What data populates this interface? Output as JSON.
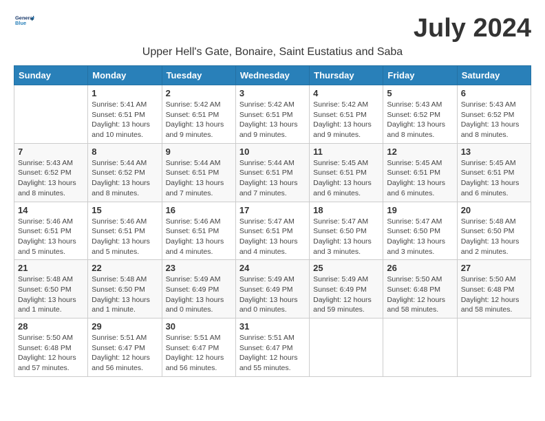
{
  "header": {
    "logo_line1": "General",
    "logo_line2": "Blue",
    "month_year": "July 2024",
    "location": "Upper Hell's Gate, Bonaire, Saint Eustatius and Saba"
  },
  "weekdays": [
    "Sunday",
    "Monday",
    "Tuesday",
    "Wednesday",
    "Thursday",
    "Friday",
    "Saturday"
  ],
  "weeks": [
    [
      {
        "day": "",
        "info": ""
      },
      {
        "day": "1",
        "info": "Sunrise: 5:41 AM\nSunset: 6:51 PM\nDaylight: 13 hours\nand 10 minutes."
      },
      {
        "day": "2",
        "info": "Sunrise: 5:42 AM\nSunset: 6:51 PM\nDaylight: 13 hours\nand 9 minutes."
      },
      {
        "day": "3",
        "info": "Sunrise: 5:42 AM\nSunset: 6:51 PM\nDaylight: 13 hours\nand 9 minutes."
      },
      {
        "day": "4",
        "info": "Sunrise: 5:42 AM\nSunset: 6:51 PM\nDaylight: 13 hours\nand 9 minutes."
      },
      {
        "day": "5",
        "info": "Sunrise: 5:43 AM\nSunset: 6:52 PM\nDaylight: 13 hours\nand 8 minutes."
      },
      {
        "day": "6",
        "info": "Sunrise: 5:43 AM\nSunset: 6:52 PM\nDaylight: 13 hours\nand 8 minutes."
      }
    ],
    [
      {
        "day": "7",
        "info": "Sunrise: 5:43 AM\nSunset: 6:52 PM\nDaylight: 13 hours\nand 8 minutes."
      },
      {
        "day": "8",
        "info": "Sunrise: 5:44 AM\nSunset: 6:52 PM\nDaylight: 13 hours\nand 8 minutes."
      },
      {
        "day": "9",
        "info": "Sunrise: 5:44 AM\nSunset: 6:51 PM\nDaylight: 13 hours\nand 7 minutes."
      },
      {
        "day": "10",
        "info": "Sunrise: 5:44 AM\nSunset: 6:51 PM\nDaylight: 13 hours\nand 7 minutes."
      },
      {
        "day": "11",
        "info": "Sunrise: 5:45 AM\nSunset: 6:51 PM\nDaylight: 13 hours\nand 6 minutes."
      },
      {
        "day": "12",
        "info": "Sunrise: 5:45 AM\nSunset: 6:51 PM\nDaylight: 13 hours\nand 6 minutes."
      },
      {
        "day": "13",
        "info": "Sunrise: 5:45 AM\nSunset: 6:51 PM\nDaylight: 13 hours\nand 6 minutes."
      }
    ],
    [
      {
        "day": "14",
        "info": "Sunrise: 5:46 AM\nSunset: 6:51 PM\nDaylight: 13 hours\nand 5 minutes."
      },
      {
        "day": "15",
        "info": "Sunrise: 5:46 AM\nSunset: 6:51 PM\nDaylight: 13 hours\nand 5 minutes."
      },
      {
        "day": "16",
        "info": "Sunrise: 5:46 AM\nSunset: 6:51 PM\nDaylight: 13 hours\nand 4 minutes."
      },
      {
        "day": "17",
        "info": "Sunrise: 5:47 AM\nSunset: 6:51 PM\nDaylight: 13 hours\nand 4 minutes."
      },
      {
        "day": "18",
        "info": "Sunrise: 5:47 AM\nSunset: 6:50 PM\nDaylight: 13 hours\nand 3 minutes."
      },
      {
        "day": "19",
        "info": "Sunrise: 5:47 AM\nSunset: 6:50 PM\nDaylight: 13 hours\nand 3 minutes."
      },
      {
        "day": "20",
        "info": "Sunrise: 5:48 AM\nSunset: 6:50 PM\nDaylight: 13 hours\nand 2 minutes."
      }
    ],
    [
      {
        "day": "21",
        "info": "Sunrise: 5:48 AM\nSunset: 6:50 PM\nDaylight: 13 hours\nand 1 minute."
      },
      {
        "day": "22",
        "info": "Sunrise: 5:48 AM\nSunset: 6:50 PM\nDaylight: 13 hours\nand 1 minute."
      },
      {
        "day": "23",
        "info": "Sunrise: 5:49 AM\nSunset: 6:49 PM\nDaylight: 13 hours\nand 0 minutes."
      },
      {
        "day": "24",
        "info": "Sunrise: 5:49 AM\nSunset: 6:49 PM\nDaylight: 13 hours\nand 0 minutes."
      },
      {
        "day": "25",
        "info": "Sunrise: 5:49 AM\nSunset: 6:49 PM\nDaylight: 12 hours\nand 59 minutes."
      },
      {
        "day": "26",
        "info": "Sunrise: 5:50 AM\nSunset: 6:48 PM\nDaylight: 12 hours\nand 58 minutes."
      },
      {
        "day": "27",
        "info": "Sunrise: 5:50 AM\nSunset: 6:48 PM\nDaylight: 12 hours\nand 58 minutes."
      }
    ],
    [
      {
        "day": "28",
        "info": "Sunrise: 5:50 AM\nSunset: 6:48 PM\nDaylight: 12 hours\nand 57 minutes."
      },
      {
        "day": "29",
        "info": "Sunrise: 5:51 AM\nSunset: 6:47 PM\nDaylight: 12 hours\nand 56 minutes."
      },
      {
        "day": "30",
        "info": "Sunrise: 5:51 AM\nSunset: 6:47 PM\nDaylight: 12 hours\nand 56 minutes."
      },
      {
        "day": "31",
        "info": "Sunrise: 5:51 AM\nSunset: 6:47 PM\nDaylight: 12 hours\nand 55 minutes."
      },
      {
        "day": "",
        "info": ""
      },
      {
        "day": "",
        "info": ""
      },
      {
        "day": "",
        "info": ""
      }
    ]
  ]
}
